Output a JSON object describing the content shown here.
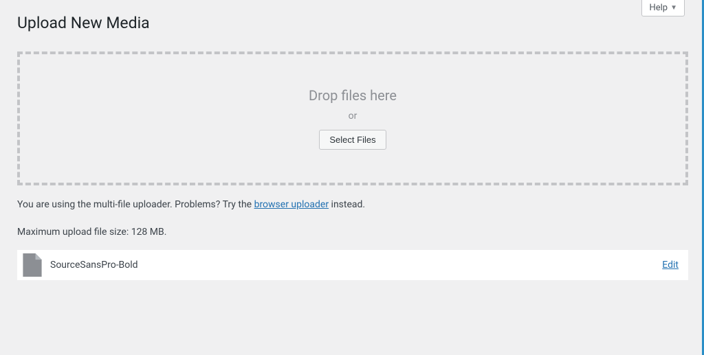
{
  "header": {
    "help_label": "Help"
  },
  "page": {
    "title": "Upload New Media"
  },
  "dropzone": {
    "title": "Drop files here",
    "or": "or",
    "button": "Select Files"
  },
  "info": {
    "prefix": "You are using the multi-file uploader. Problems? Try the ",
    "link": "browser uploader",
    "suffix": " instead."
  },
  "max_size": "Maximum upload file size: 128 MB.",
  "media_items": [
    {
      "name": "SourceSansPro-Bold",
      "action": "Edit"
    }
  ]
}
